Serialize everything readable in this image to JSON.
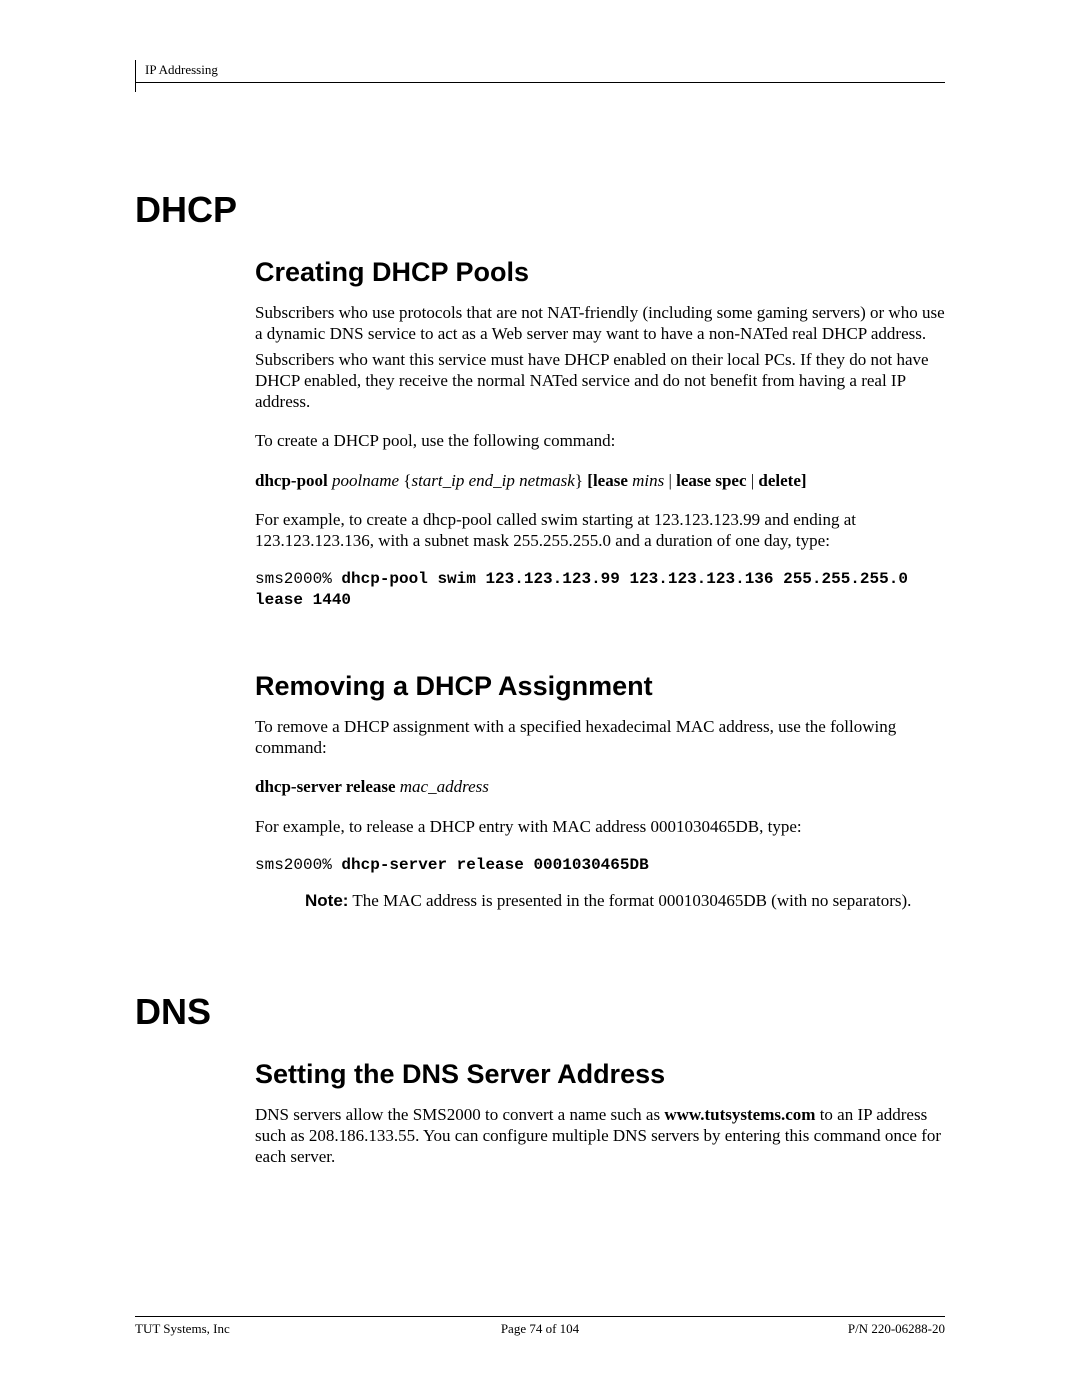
{
  "header": {
    "section": "IP Addressing"
  },
  "sections": {
    "dhcp": {
      "title": "DHCP",
      "creating": {
        "title": "Creating DHCP Pools",
        "p1": "Subscribers who use protocols that are not NAT-friendly (including some gaming servers)  or who use a dynamic DNS service to act as a Web server may want to have a non-NATed real DHCP address.",
        "p2": "Subscribers who want this service must have DHCP enabled on their local PCs. If they do not have DHCP enabled, they receive the normal NATed service and do not benefit from having a real IP address.",
        "p3": "To create a DHCP pool, use the following command:",
        "syntax": {
          "cmd": "dhcp-pool",
          "arg1": " poolname",
          "brace_open": " {",
          "args2": "start_ip end_ip netmask",
          "brace_close": "} ",
          "opt_open": "[lease ",
          "opt_mins": "mins",
          "opt_sep1": " | ",
          "opt_spec": "lease spec",
          "opt_sep2": " | ",
          "opt_del": "delete]"
        },
        "p4": "For example, to create a dhcp-pool called swim starting at 123.123.123.99 and ending at 123.123.123.136, with a subnet mask 255.255.255.0 and a duration of one day, type:",
        "code_prompt1": "sms2000% ",
        "code_cmd1": "dhcp-pool swim 123.123.123.99 123.123.123.136 255.255.255.0 lease 1440"
      },
      "removing": {
        "title": "Removing a DHCP Assignment",
        "p1": "To remove a DHCP assignment with a specified hexadecimal MAC address, use the following command:",
        "syntax": {
          "cmd": "dhcp-server release",
          "arg": " mac_address"
        },
        "p2": "For example, to release a DHCP entry with MAC address 0001030465DB, type:",
        "code_prompt1": "sms2000% ",
        "code_cmd1": "dhcp-server release 0001030465DB",
        "note_label": "Note:",
        "note_text": "  The MAC address is presented in the format 0001030465DB (with no separators)."
      }
    },
    "dns": {
      "title": "DNS",
      "setting": {
        "title": "Setting the DNS Server Address",
        "p1a": "DNS servers allow the SMS2000 to convert a name such as ",
        "p1b": "www.tutsystems.com",
        "p1c": " to an IP address such as 208.186.133.55. You can configure multiple DNS servers by entering this command once for each server."
      }
    }
  },
  "footer": {
    "left": "TUT Systems, Inc",
    "center": "Page 74 of 104",
    "right_label": "P/N ",
    "right_value": "220-06288-20"
  }
}
